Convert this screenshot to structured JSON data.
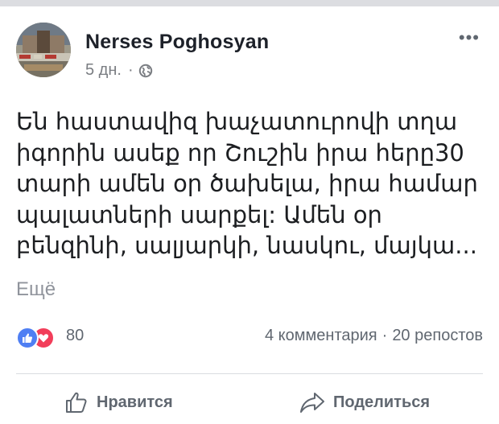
{
  "post": {
    "author": "Nerses Poghosyan",
    "time": "5 дн.",
    "time_separator": "·",
    "privacy_icon": "globe-icon",
    "more_menu": "•••",
    "text_lines": [
      "Են հաստավիզ խաչատուրովի տղա",
      "իգորին ասեք որ Շուշին իրա հերը30",
      "տարի ամեն օր ծախելա, իրա համար",
      "պալատների սարքել: Ամեն օր",
      "բենզինի, սալյարկի, նասկու, մայկա..."
    ],
    "see_more": "Ещё"
  },
  "reactions": {
    "icons": [
      "like-icon",
      "love-icon"
    ],
    "count": "80",
    "comments": "4 комментария",
    "separator": "·",
    "shares": "20 репостов"
  },
  "actions": {
    "like_label": "Нравится",
    "share_label": "Поделиться"
  },
  "colors": {
    "like_blue": "#4f7ff3",
    "love_red": "#f23e5a",
    "secondary_text": "#606770"
  }
}
